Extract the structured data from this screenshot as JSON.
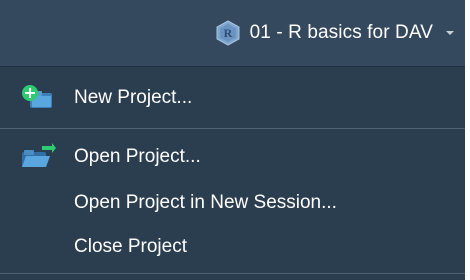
{
  "header": {
    "project_name": "01 - R basics for DAV",
    "project_icon": "r-project-icon",
    "dropdown_icon": "chevron-down-icon"
  },
  "menu": {
    "items": [
      {
        "label": "New Project...",
        "icon": "new-project-icon"
      },
      {
        "label": "Open Project...",
        "icon": "open-project-icon"
      },
      {
        "label": "Open Project in New Session...",
        "icon": ""
      },
      {
        "label": "Close Project",
        "icon": ""
      }
    ]
  },
  "colors": {
    "header_bg": "#34495e",
    "menu_bg": "#2b3e50",
    "text": "#ffffff",
    "accent_green": "#2ecc71",
    "accent_blue": "#3498db"
  }
}
